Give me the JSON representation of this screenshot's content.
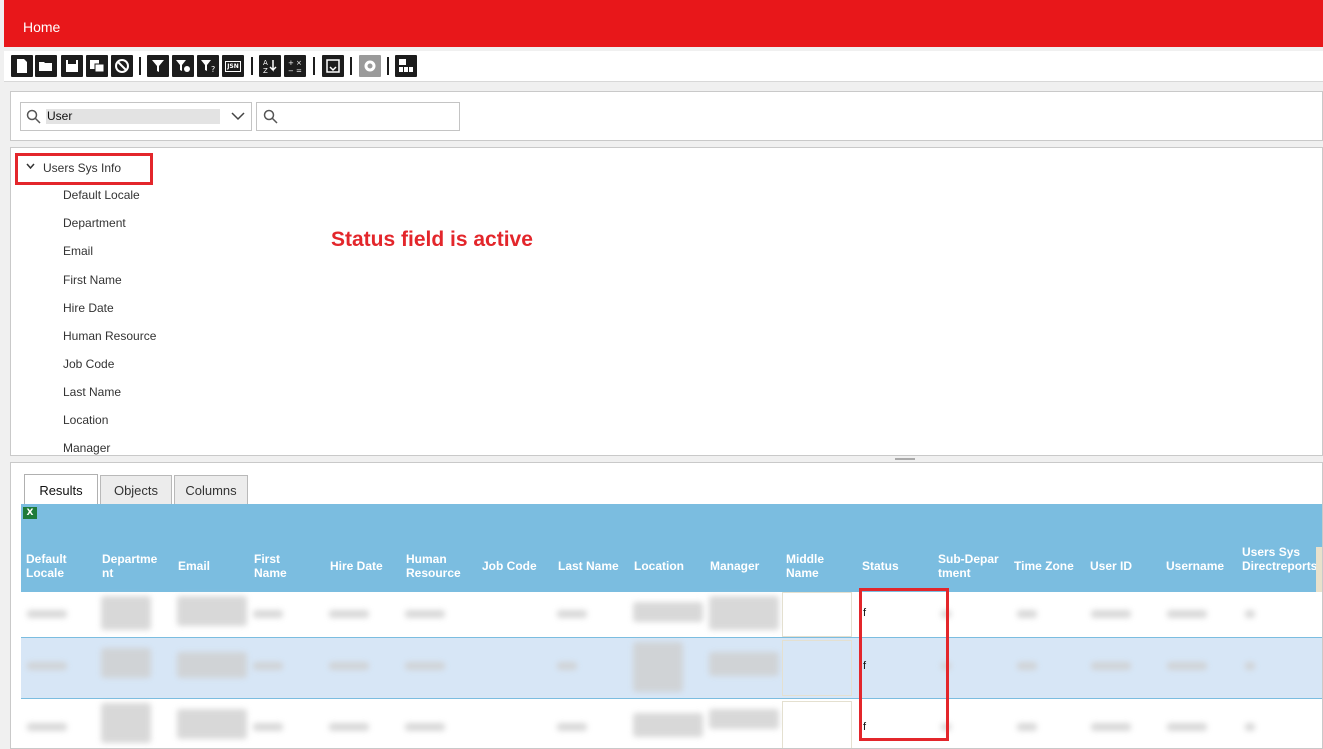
{
  "header": {
    "home_label": "Home"
  },
  "toolbar": {
    "icons": [
      "new-icon",
      "open-icon",
      "save-icon",
      "save-as-icon",
      "cancel-icon",
      "filter-icon",
      "filter-settings-icon",
      "filter-help-icon",
      "json-icon",
      "sort-icon",
      "formula-icon",
      "refresh-icon",
      "settings-icon",
      "report-icon"
    ],
    "json_label": "JSN"
  },
  "search": {
    "object_value": "User",
    "query_value": ""
  },
  "tree": {
    "root_label": "Users Sys Info",
    "items": [
      "Default Locale",
      "Department",
      "Email",
      "First Name",
      "Hire Date",
      "Human Resource",
      "Job Code",
      "Last Name",
      "Location",
      "Manager"
    ]
  },
  "annotation": {
    "text": "Status field is active"
  },
  "tabs": [
    {
      "label": "Results"
    },
    {
      "label": "Objects"
    },
    {
      "label": "Columns"
    }
  ],
  "columns": [
    {
      "h1": "Default",
      "h2": "Locale"
    },
    {
      "h1": "Departme",
      "h2": "nt"
    },
    {
      "h1": "Email",
      "h2": ""
    },
    {
      "h1": "First",
      "h2": "Name"
    },
    {
      "h1": "Hire Date",
      "h2": ""
    },
    {
      "h1": "Human",
      "h2": "Resource"
    },
    {
      "h1": "Job Code",
      "h2": ""
    },
    {
      "h1": "Last Name",
      "h2": ""
    },
    {
      "h1": "Location",
      "h2": ""
    },
    {
      "h1": "Manager",
      "h2": ""
    },
    {
      "h1": "Middle",
      "h2": "Name"
    },
    {
      "h1": "Status",
      "h2": ""
    },
    {
      "h1": "Sub-Depar",
      "h2": "tment"
    },
    {
      "h1": "Time Zone",
      "h2": ""
    },
    {
      "h1": "User ID",
      "h2": ""
    },
    {
      "h1": "Username",
      "h2": ""
    },
    {
      "h1": "Users Sys",
      "h2": "Directreports"
    }
  ],
  "rows": [
    {
      "status": "f"
    },
    {
      "status": "f"
    },
    {
      "status": "f"
    }
  ],
  "colors": {
    "brand_red": "#e8171a",
    "grid_header": "#7bbde0",
    "highlight": "#e3262b"
  }
}
